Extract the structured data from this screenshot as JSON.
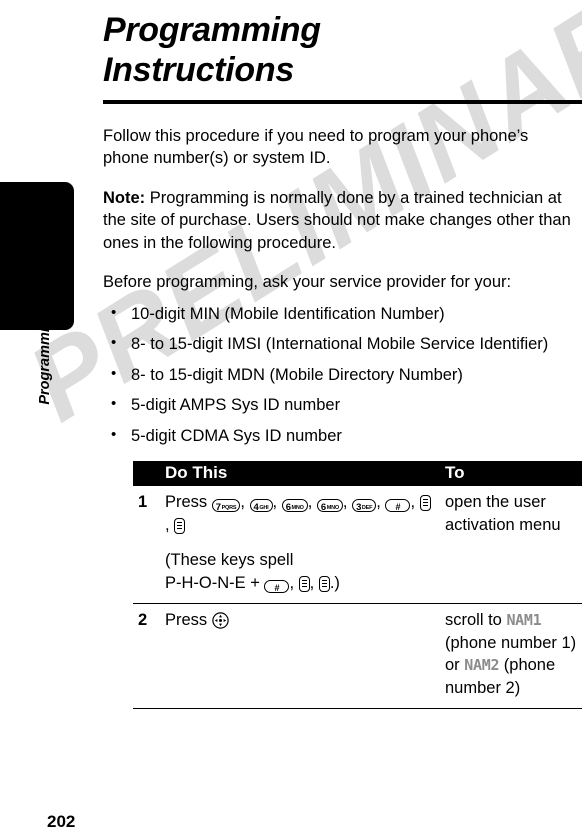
{
  "page": {
    "title": "Programming Instructions",
    "side_tab_title": "Programming Instructions",
    "page_number": "202",
    "watermark": "PRELIMINARY"
  },
  "body": {
    "intro": "Follow this procedure if you need to program your phone’s phone number(s) or system ID.",
    "note_label": "Note:",
    "note_text": " Programming is normally done by a trained technician at the site of purchase. Users should not make changes other than ones in the following procedure.",
    "before": "Before programming, ask your service provider for your:",
    "bullets": [
      "10-digit MIN (Mobile Identification Number)",
      "8- to 15-digit IMSI (International Mobile Service Identifier)",
      "8- to 15-digit MDN (Mobile Directory Number)",
      "5-digit AMPS Sys ID number",
      "5-digit CDMA Sys ID number"
    ]
  },
  "table": {
    "headers": {
      "number": "",
      "do_this": "Do This",
      "to": "To"
    },
    "rows": [
      {
        "number": "1",
        "press_label": "Press ",
        "keys": [
          {
            "type": "digit",
            "digit": "7",
            "letters": "PQRS"
          },
          {
            "type": "digit",
            "digit": "4",
            "letters": "GHI"
          },
          {
            "type": "digit",
            "digit": "6",
            "letters": "MNO"
          },
          {
            "type": "digit",
            "digit": "6",
            "letters": "MNO"
          },
          {
            "type": "digit",
            "digit": "3",
            "letters": "DEF"
          },
          {
            "type": "hash",
            "digit": "#",
            "letters": ""
          },
          {
            "type": "softkey",
            "digit": "",
            "letters": ""
          },
          {
            "type": "softkey",
            "digit": "",
            "letters": ""
          }
        ],
        "note_prefix": "(These keys spell",
        "note_spell": "P-H-O-N-E + ",
        "note_keys": [
          {
            "type": "hash",
            "digit": "#",
            "letters": ""
          },
          {
            "type": "softkey",
            "digit": "",
            "letters": ""
          },
          {
            "type": "softkey",
            "digit": "",
            "letters": ""
          }
        ],
        "note_suffix": ".)",
        "to": "open the user activation menu"
      },
      {
        "number": "2",
        "press_label": "Press ",
        "keys": [
          {
            "type": "navkey",
            "digit": "",
            "letters": ""
          }
        ],
        "to_parts": [
          {
            "text": "scroll to ",
            "style": "normal"
          },
          {
            "text": "NAM1",
            "style": "lcd"
          },
          {
            "text": " (phone number 1) or ",
            "style": "normal"
          },
          {
            "text": "NAM2",
            "style": "lcd"
          },
          {
            "text": " (phone number 2)",
            "style": "normal"
          }
        ]
      }
    ]
  }
}
